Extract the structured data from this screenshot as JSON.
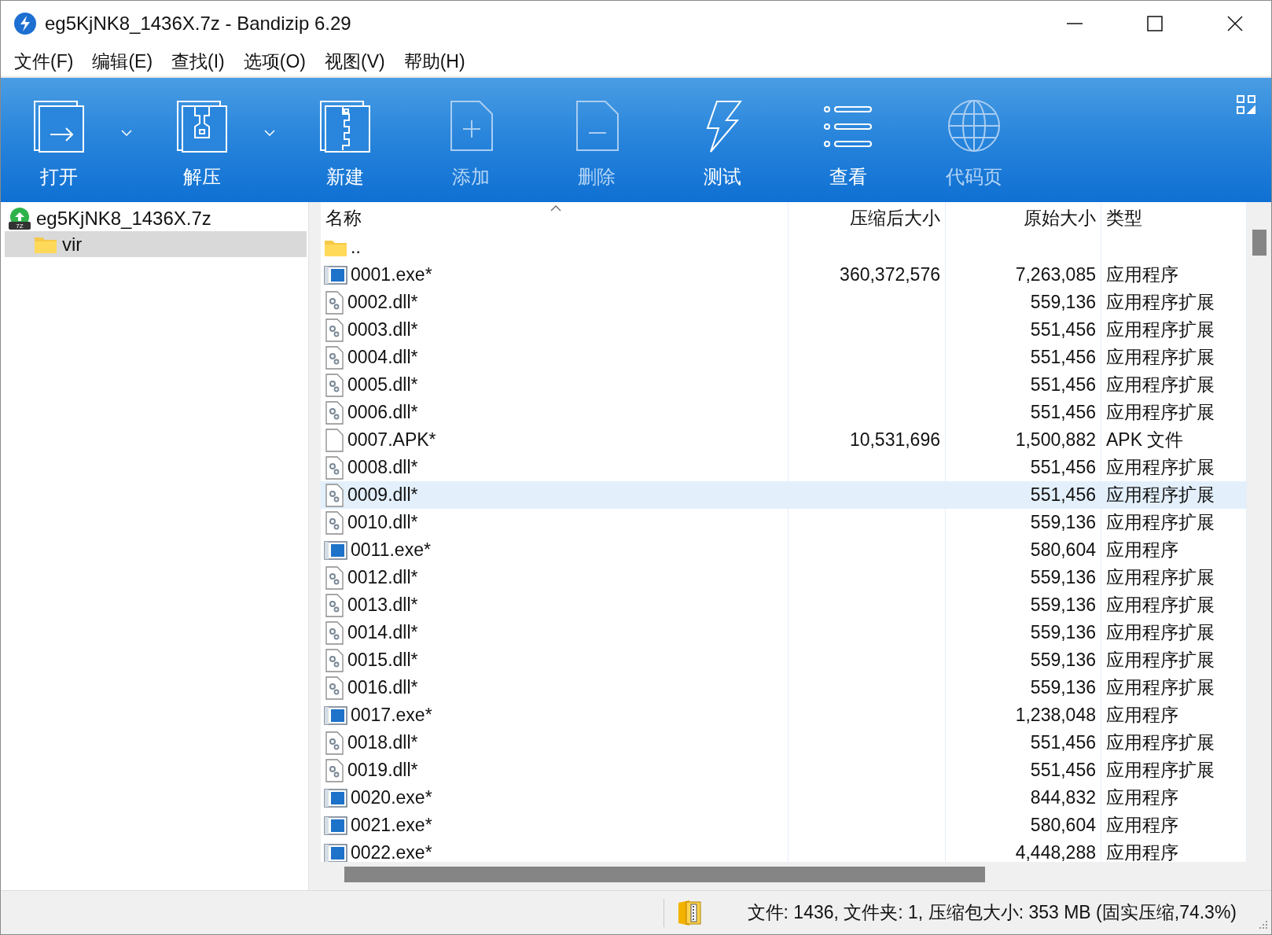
{
  "window": {
    "title": "eg5KjNK8_1436X.7z - Bandizip 6.29"
  },
  "menu": [
    "文件(F)",
    "编辑(E)",
    "查找(I)",
    "选项(O)",
    "视图(V)",
    "帮助(H)"
  ],
  "toolbar": [
    {
      "kind": "open",
      "label": "打开",
      "dropdown": true,
      "disabled": false
    },
    {
      "kind": "extract",
      "label": "解压",
      "dropdown": true,
      "disabled": false
    },
    {
      "kind": "new",
      "label": "新建",
      "dropdown": false,
      "disabled": false
    },
    {
      "kind": "add",
      "label": "添加",
      "dropdown": false,
      "disabled": true
    },
    {
      "kind": "delete",
      "label": "删除",
      "dropdown": false,
      "disabled": true
    },
    {
      "kind": "test",
      "label": "测试",
      "dropdown": false,
      "disabled": false
    },
    {
      "kind": "view",
      "label": "查看",
      "dropdown": false,
      "disabled": false
    },
    {
      "kind": "codepage",
      "label": "代码页",
      "dropdown": false,
      "disabled": true
    }
  ],
  "tree": [
    {
      "label": "eg5KjNK8_1436X.7z",
      "kind": "archive",
      "icon_label": "7Z",
      "selected": false,
      "children": [
        {
          "label": "vir",
          "kind": "folder",
          "selected": true
        }
      ]
    }
  ],
  "table": {
    "columns": [
      "名称",
      "压缩后大小",
      "原始大小",
      "类型"
    ],
    "rows": [
      {
        "kind": "folder",
        "name": "..",
        "selected": false
      },
      {
        "kind": "exe",
        "name": "0001.exe*",
        "packed": "360,372,576",
        "size": "7,263,085",
        "type": "应用程序",
        "selected": false
      },
      {
        "kind": "dll",
        "name": "0002.dll*",
        "size": "559,136",
        "type": "应用程序扩展",
        "selected": false
      },
      {
        "kind": "dll",
        "name": "0003.dll*",
        "size": "551,456",
        "type": "应用程序扩展",
        "selected": false
      },
      {
        "kind": "dll",
        "name": "0004.dll*",
        "size": "551,456",
        "type": "应用程序扩展",
        "selected": false
      },
      {
        "kind": "dll",
        "name": "0005.dll*",
        "size": "551,456",
        "type": "应用程序扩展",
        "selected": false
      },
      {
        "kind": "dll",
        "name": "0006.dll*",
        "size": "551,456",
        "type": "应用程序扩展",
        "selected": false
      },
      {
        "kind": "file",
        "name": "0007.APK*",
        "packed": "10,531,696",
        "size": "1,500,882",
        "type": "APK 文件",
        "selected": false
      },
      {
        "kind": "dll",
        "name": "0008.dll*",
        "size": "551,456",
        "type": "应用程序扩展",
        "selected": false
      },
      {
        "kind": "dll",
        "name": "0009.dll*",
        "size": "551,456",
        "type": "应用程序扩展",
        "selected": true
      },
      {
        "kind": "dll",
        "name": "0010.dll*",
        "size": "559,136",
        "type": "应用程序扩展",
        "selected": false
      },
      {
        "kind": "exe",
        "name": "0011.exe*",
        "size": "580,604",
        "type": "应用程序",
        "selected": false
      },
      {
        "kind": "dll",
        "name": "0012.dll*",
        "size": "559,136",
        "type": "应用程序扩展",
        "selected": false
      },
      {
        "kind": "dll",
        "name": "0013.dll*",
        "size": "559,136",
        "type": "应用程序扩展",
        "selected": false
      },
      {
        "kind": "dll",
        "name": "0014.dll*",
        "size": "559,136",
        "type": "应用程序扩展",
        "selected": false
      },
      {
        "kind": "dll",
        "name": "0015.dll*",
        "size": "559,136",
        "type": "应用程序扩展",
        "selected": false
      },
      {
        "kind": "dll",
        "name": "0016.dll*",
        "size": "559,136",
        "type": "应用程序扩展",
        "selected": false
      },
      {
        "kind": "exe",
        "name": "0017.exe*",
        "size": "1,238,048",
        "type": "应用程序",
        "selected": false
      },
      {
        "kind": "dll",
        "name": "0018.dll*",
        "size": "551,456",
        "type": "应用程序扩展",
        "selected": false
      },
      {
        "kind": "dll",
        "name": "0019.dll*",
        "size": "551,456",
        "type": "应用程序扩展",
        "selected": false
      },
      {
        "kind": "exe",
        "name": "0020.exe*",
        "size": "844,832",
        "type": "应用程序",
        "selected": false
      },
      {
        "kind": "exe",
        "name": "0021.exe*",
        "size": "580,604",
        "type": "应用程序",
        "selected": false
      },
      {
        "kind": "exe",
        "name": "0022.exe*",
        "size": "4,448,288",
        "type": "应用程序",
        "selected": false
      }
    ]
  },
  "status_bar": {
    "text": "文件: 1436, 文件夹: 1, 压缩包大小: 353 MB (固实压缩,74.3%)"
  }
}
